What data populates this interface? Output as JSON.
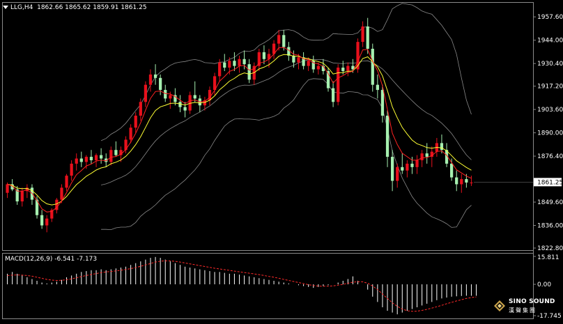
{
  "header": {
    "symbol": "LLG,H4",
    "ohlc": "1862.66 1865.62 1859.91 1861.25"
  },
  "macd_header": {
    "label": "MACD(12,26,9)",
    "values": "-6.541 -7.173"
  },
  "colors": {
    "background": "#000000",
    "bull_candle": "#e8101c",
    "bear_candle": "#a6f0b0",
    "ma_fast": "#ff2222",
    "ma_slow": "#ffff33",
    "bollinger": "#8a8a8a",
    "macd_hist": "#ffffff",
    "macd_signal": "#ff2a2a",
    "grid_frame": "#8a8a8a"
  },
  "logo": {
    "line1": "SINO SOUND",
    "line2": "漢聲集團",
    "icon": "diamond-logo-icon"
  },
  "chart_data": [
    {
      "type": "candlestick",
      "title": "LLG,H4",
      "y_ticks": [
        1957.6,
        1944.0,
        1930.4,
        1917.2,
        1903.6,
        1890.0,
        1876.4,
        1861.25,
        1849.6,
        1836.0,
        1822.8
      ],
      "current_price": 1861.25,
      "ylim": [
        1822.8,
        1965.0
      ],
      "grid": false,
      "candles": [
        [
          1855,
          1861,
          1852,
          1860
        ],
        [
          1860,
          1863,
          1856,
          1857
        ],
        [
          1857,
          1859,
          1848,
          1850
        ],
        [
          1850,
          1858,
          1847,
          1856
        ],
        [
          1856,
          1860,
          1852,
          1858
        ],
        [
          1858,
          1860,
          1848,
          1851
        ],
        [
          1851,
          1853,
          1840,
          1842
        ],
        [
          1842,
          1845,
          1834,
          1836
        ],
        [
          1836,
          1842,
          1832,
          1840
        ],
        [
          1840,
          1846,
          1838,
          1845
        ],
        [
          1845,
          1852,
          1843,
          1851
        ],
        [
          1851,
          1860,
          1849,
          1858
        ],
        [
          1858,
          1866,
          1856,
          1865
        ],
        [
          1865,
          1874,
          1862,
          1872
        ],
        [
          1872,
          1878,
          1868,
          1875
        ],
        [
          1875,
          1879,
          1870,
          1873
        ],
        [
          1873,
          1877,
          1869,
          1876
        ],
        [
          1876,
          1880,
          1872,
          1874
        ],
        [
          1874,
          1878,
          1870,
          1877
        ],
        [
          1877,
          1881,
          1872,
          1875
        ],
        [
          1875,
          1878,
          1870,
          1873
        ],
        [
          1873,
          1882,
          1871,
          1880
        ],
        [
          1880,
          1885,
          1876,
          1877
        ],
        [
          1877,
          1882,
          1873,
          1880
        ],
        [
          1880,
          1888,
          1878,
          1886
        ],
        [
          1886,
          1895,
          1884,
          1893
        ],
        [
          1893,
          1902,
          1890,
          1900
        ],
        [
          1900,
          1910,
          1897,
          1908
        ],
        [
          1908,
          1920,
          1905,
          1918
        ],
        [
          1918,
          1927,
          1914,
          1924
        ],
        [
          1924,
          1930,
          1918,
          1922
        ],
        [
          1922,
          1924,
          1912,
          1915
        ],
        [
          1915,
          1918,
          1908,
          1910
        ],
        [
          1910,
          1914,
          1904,
          1912
        ],
        [
          1912,
          1916,
          1906,
          1908
        ],
        [
          1908,
          1912,
          1902,
          1905
        ],
        [
          1905,
          1908,
          1899,
          1903
        ],
        [
          1903,
          1914,
          1901,
          1912
        ],
        [
          1912,
          1920,
          1908,
          1910
        ],
        [
          1910,
          1912,
          1902,
          1906
        ],
        [
          1906,
          1911,
          1903,
          1909
        ],
        [
          1909,
          1917,
          1906,
          1915
        ],
        [
          1915,
          1925,
          1912,
          1923
        ],
        [
          1923,
          1933,
          1920,
          1931
        ],
        [
          1931,
          1936,
          1926,
          1928
        ],
        [
          1928,
          1934,
          1924,
          1932
        ],
        [
          1932,
          1937,
          1926,
          1929
        ],
        [
          1929,
          1935,
          1925,
          1933
        ],
        [
          1933,
          1938,
          1927,
          1930
        ],
        [
          1930,
          1933,
          1919,
          1921
        ],
        [
          1921,
          1931,
          1918,
          1929
        ],
        [
          1929,
          1939,
          1926,
          1937
        ],
        [
          1937,
          1941,
          1930,
          1933
        ],
        [
          1933,
          1939,
          1928,
          1936
        ],
        [
          1936,
          1944,
          1933,
          1942
        ],
        [
          1942,
          1950,
          1938,
          1947
        ],
        [
          1947,
          1950,
          1938,
          1940
        ],
        [
          1940,
          1943,
          1932,
          1935
        ],
        [
          1935,
          1938,
          1928,
          1931
        ],
        [
          1931,
          1936,
          1927,
          1934
        ],
        [
          1934,
          1937,
          1927,
          1929
        ],
        [
          1929,
          1934,
          1926,
          1932
        ],
        [
          1932,
          1935,
          1925,
          1927
        ],
        [
          1927,
          1931,
          1924,
          1929
        ],
        [
          1929,
          1933,
          1924,
          1926
        ],
        [
          1926,
          1928,
          1914,
          1916
        ],
        [
          1916,
          1920,
          1905,
          1908
        ],
        [
          1908,
          1930,
          1906,
          1928
        ],
        [
          1928,
          1932,
          1924,
          1926
        ],
        [
          1926,
          1931,
          1923,
          1929
        ],
        [
          1929,
          1933,
          1925,
          1927
        ],
        [
          1927,
          1945,
          1925,
          1943
        ],
        [
          1943,
          1955,
          1940,
          1952
        ],
        [
          1952,
          1957,
          1936,
          1939
        ],
        [
          1939,
          1942,
          1914,
          1918
        ],
        [
          1918,
          1924,
          1910,
          1915
        ],
        [
          1915,
          1918,
          1896,
          1900
        ],
        [
          1900,
          1903,
          1870,
          1876
        ],
        [
          1876,
          1880,
          1856,
          1862
        ],
        [
          1862,
          1872,
          1858,
          1870
        ],
        [
          1870,
          1878,
          1866,
          1868
        ],
        [
          1868,
          1874,
          1864,
          1872
        ],
        [
          1872,
          1876,
          1866,
          1870
        ],
        [
          1870,
          1877,
          1866,
          1874
        ],
        [
          1874,
          1880,
          1870,
          1878
        ],
        [
          1878,
          1884,
          1872,
          1876
        ],
        [
          1876,
          1882,
          1870,
          1879
        ],
        [
          1879,
          1887,
          1876,
          1884
        ],
        [
          1884,
          1889,
          1878,
          1880
        ],
        [
          1880,
          1884,
          1870,
          1872
        ],
        [
          1872,
          1875,
          1862,
          1864
        ],
        [
          1864,
          1868,
          1856,
          1860
        ],
        [
          1860,
          1866,
          1855,
          1863
        ],
        [
          1863,
          1866,
          1858,
          1861
        ],
        [
          1861,
          1865,
          1859,
          1861
        ]
      ]
    },
    {
      "type": "bar",
      "title": "MACD(12,26,9)",
      "y_ticks": [
        15.811,
        0.0,
        -17.745
      ],
      "ylim": [
        -17.745,
        15.811
      ],
      "histogram": [
        6,
        7,
        6,
        5,
        4,
        3,
        2,
        1,
        0.5,
        1,
        1.5,
        2.5,
        4,
        5,
        6,
        7,
        7.5,
        8,
        8,
        8.5,
        8,
        8.5,
        9,
        9.5,
        10,
        11,
        12,
        13,
        14,
        15,
        15.5,
        15,
        14,
        13,
        12,
        11,
        10,
        9.5,
        9,
        8.5,
        8,
        7.5,
        7,
        7,
        6.5,
        6,
        6,
        5.5,
        5,
        4.5,
        4,
        3.5,
        3,
        2.5,
        2,
        1.5,
        1,
        0.5,
        0,
        -0.5,
        -1,
        -1.5,
        -2,
        -1.5,
        -1,
        -0.5,
        0,
        1,
        2,
        3,
        4.5,
        2,
        0,
        -3,
        -7,
        -10,
        -13,
        -15,
        -16,
        -17,
        -16,
        -15,
        -14,
        -13,
        -12,
        -11,
        -10,
        -9,
        -8,
        -7.5,
        -7,
        -6.8,
        -6.6,
        -6.5,
        -6.5,
        -6.5
      ],
      "signal": [
        5,
        5.2,
        5.3,
        5.2,
        5,
        4.6,
        4,
        3.4,
        2.8,
        2.4,
        2.2,
        2.3,
        2.6,
        3.1,
        3.7,
        4.4,
        5,
        5.6,
        6.1,
        6.6,
        7,
        7.3,
        7.6,
        8,
        8.4,
        8.9,
        9.5,
        10.2,
        11,
        11.8,
        12.6,
        13.1,
        13.3,
        13.3,
        13,
        12.6,
        12.1,
        11.6,
        11.1,
        10.6,
        10.1,
        9.6,
        9.1,
        8.7,
        8.3,
        7.9,
        7.5,
        7.1,
        6.7,
        6.3,
        5.9,
        5.5,
        5,
        4.5,
        4,
        3.4,
        2.8,
        2.2,
        1.6,
        1,
        0.4,
        -0.2,
        -0.7,
        -1,
        -1.1,
        -1.1,
        -0.9,
        -0.5,
        0,
        0.6,
        1.2,
        1.5,
        1.4,
        0.6,
        -1,
        -3,
        -5.5,
        -8,
        -10.5,
        -12.5,
        -14,
        -15,
        -15.3,
        -15.2,
        -14.8,
        -14.2,
        -13.5,
        -12.7,
        -11.9,
        -11,
        -10.2,
        -9.4,
        -8.7,
        -8,
        -7.5,
        -7.173
      ],
      "macd": -6.541,
      "signal_value": -7.173
    }
  ]
}
